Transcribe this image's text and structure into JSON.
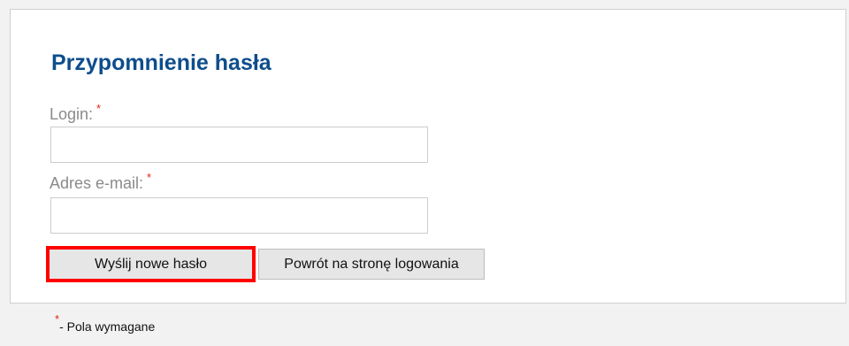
{
  "form": {
    "title": "Przypomnienie hasła",
    "required_marker": "*",
    "fields": {
      "login": {
        "label": "Login:",
        "value": "",
        "placeholder": ""
      },
      "email": {
        "label": "Adres e-mail:",
        "value": "",
        "placeholder": ""
      }
    },
    "buttons": {
      "submit_label": "Wyślij nowe hasło",
      "back_label": "Powrót na stronę logowania"
    }
  },
  "footnote": {
    "marker": "*",
    "text": "- Pola wymagane"
  },
  "colors": {
    "title": "#0d4d8c",
    "required": "#e0241b",
    "highlight": "#ff0000",
    "page_background": "#f2f2f2"
  }
}
